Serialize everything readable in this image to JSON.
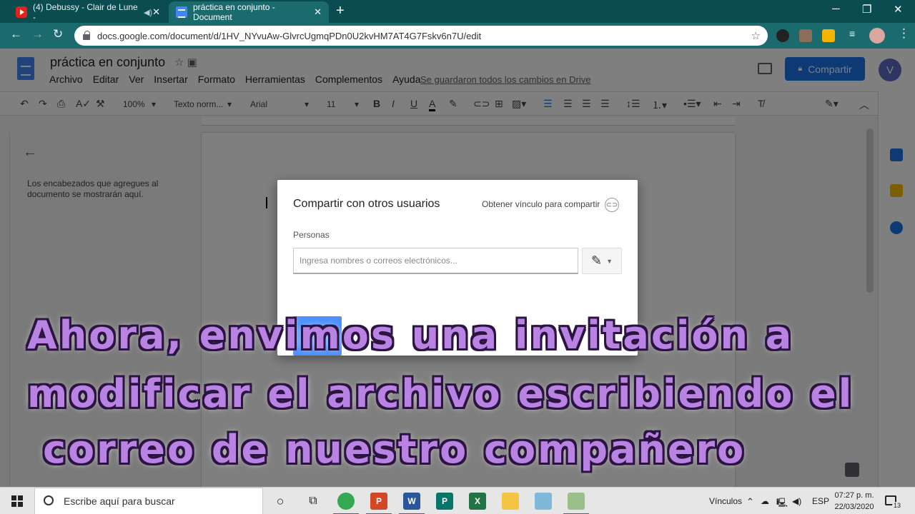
{
  "browser": {
    "tabs": [
      {
        "label": "(4) Debussy - Clair de Lune -",
        "favicon": "youtube-icon"
      },
      {
        "label": "práctica en conjunto - Document",
        "favicon": "docs-icon"
      }
    ],
    "url": "docs.google.com/document/d/1HV_NYvuAw-GlvrcUgmqPDn0U2kvHM7AT4G7Fskv6n7U/edit"
  },
  "docs": {
    "title": "práctica en conjunto",
    "menu": [
      "Archivo",
      "Editar",
      "Ver",
      "Insertar",
      "Formato",
      "Herramientas",
      "Complementos",
      "Ayuda"
    ],
    "save_status": "Se guardaron todos los cambios en Drive",
    "share_label": "Compartir",
    "avatar_letter": "V",
    "zoom": "100%",
    "style": "Texto norm...",
    "font": "Arial",
    "font_size": "11",
    "outline_empty": "Los encabezados que agregues al documento se mostrarán aquí."
  },
  "dialog": {
    "title": "Compartir con otros usuarios",
    "link_label": "Obtener vínculo para compartir",
    "people_label": "Personas",
    "input_placeholder": "Ingresa nombres o correos electrónicos..."
  },
  "caption": [
    "Ahora, envimos una invitación a",
    "modificar el archivo escribiendo el",
    "correo de nuestro compañero"
  ],
  "taskbar": {
    "search_placeholder": "Escribe aquí para buscar",
    "links_label": "Vínculos",
    "language": "ESP",
    "time": "07:27 p. m.",
    "date": "22/03/2020",
    "notification_count": "13"
  },
  "colors": {
    "chrome_frame": "#0b4c50",
    "docs_blue": "#1a73e8",
    "caption_fill": "#b983e3"
  }
}
